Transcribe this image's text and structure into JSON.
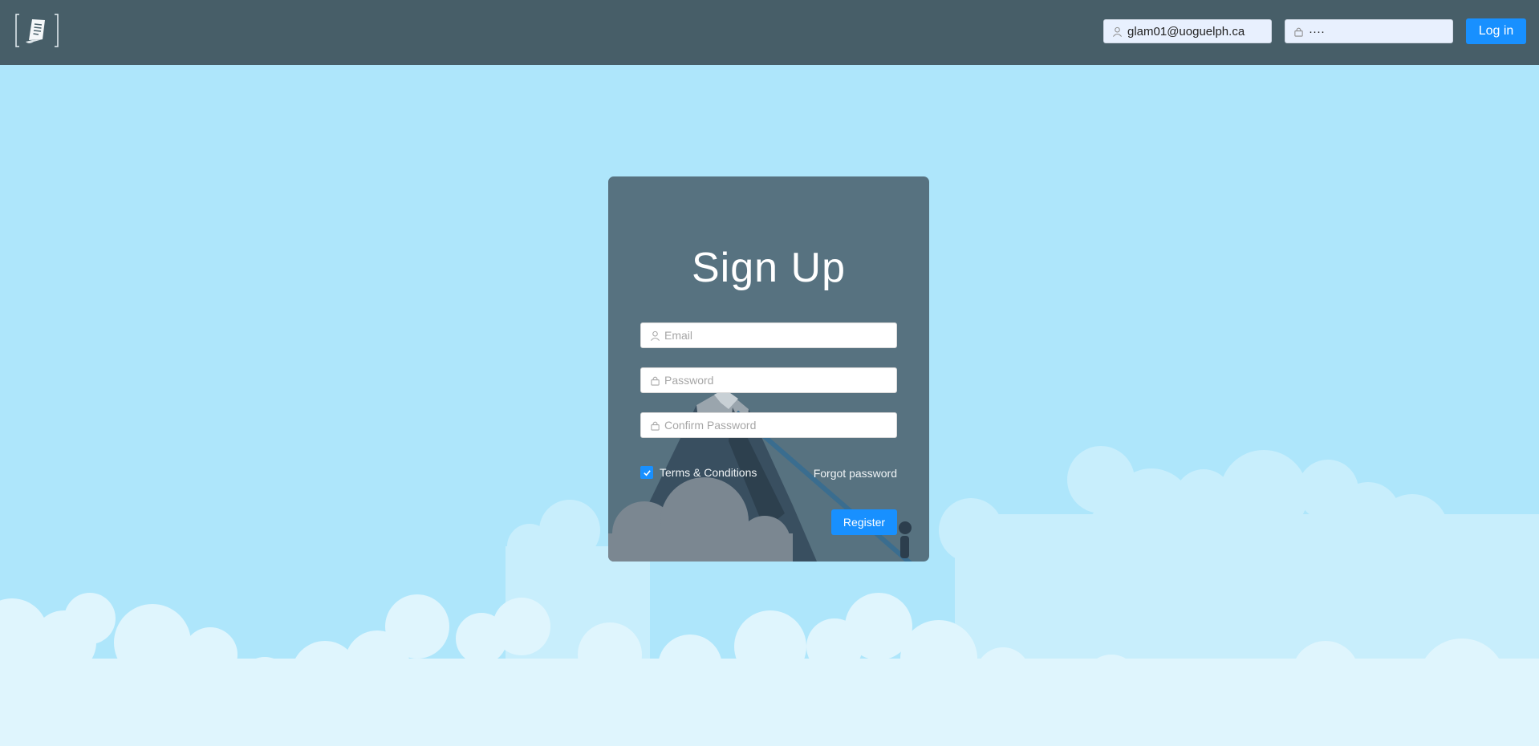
{
  "header": {
    "email_value": "glam01@uoguelph.ca",
    "password_value": "····",
    "login_label": "Log in"
  },
  "signup": {
    "title": "Sign Up",
    "email_placeholder": "Email",
    "password_placeholder": "Password",
    "confirm_placeholder": "Confirm Password",
    "terms_label": "Terms & Conditions",
    "terms_checked": true,
    "forgot_label": "Forgot password",
    "register_label": "Register"
  },
  "icons": {
    "logo": "notepad-logo-icon",
    "user": "user-icon",
    "lock": "lock-icon",
    "check": "checkmark-icon"
  },
  "colors": {
    "header_bg": "#475e68",
    "sky": "#aee6fb",
    "accent": "#1890ff",
    "card_bg": "#485e6b"
  }
}
